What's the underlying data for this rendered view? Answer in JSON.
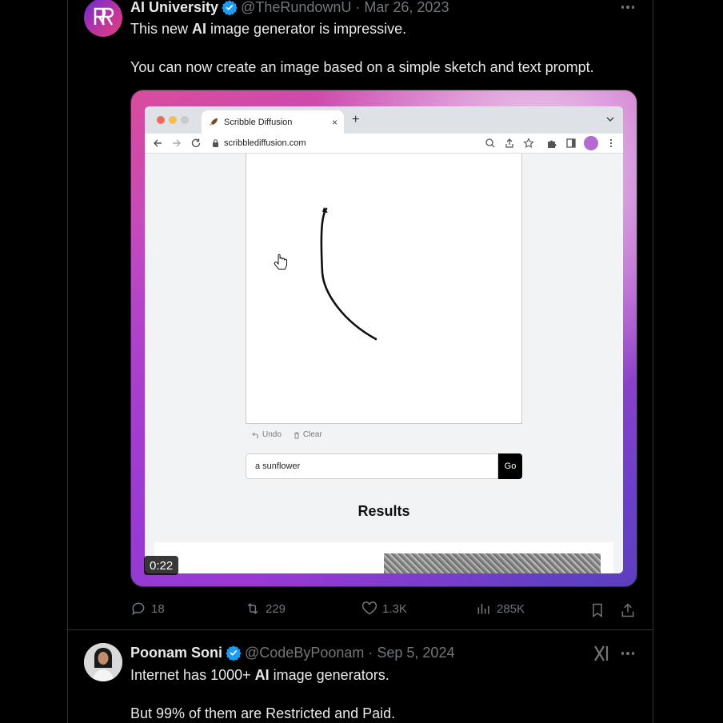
{
  "tweet1": {
    "name": "AI University",
    "handle": "@TheRundownU",
    "separator": "·",
    "date": "Mar 26, 2023",
    "text_line1_pre": "This new ",
    "text_line1_bold": "AI",
    "text_line1_post": " image generator is impressive.",
    "text_line2": "You can now create an image based on a simple sketch and text prompt.",
    "media": {
      "duration": "0:22",
      "browser": {
        "tab_title": "Scribble Diffusion",
        "tab_close": "×",
        "new_tab": "+",
        "url": "scribblediffusion.com"
      },
      "app": {
        "undo_label": "Undo",
        "clear_label": "Clear",
        "prompt_value": "a sunflower",
        "go_label": "Go",
        "results_heading": "Results"
      }
    },
    "stats": {
      "replies": "18",
      "reposts": "229",
      "likes": "1.3K",
      "views": "285K"
    }
  },
  "tweet2": {
    "name": "Poonam Soni",
    "handle": "@CodeByPoonam",
    "separator": "·",
    "date": "Sep 5, 2024",
    "text_line1_pre": "Internet has 1000+ ",
    "text_line1_bold": "AI",
    "text_line1_post": " image generators.",
    "text_line2": "But 99% of them are Restricted and Paid."
  },
  "colors": {
    "background": "#000000",
    "text": "#e7e9ea",
    "secondary": "#71767b",
    "verified": "#1d9bf0",
    "border": "#2f3336"
  }
}
